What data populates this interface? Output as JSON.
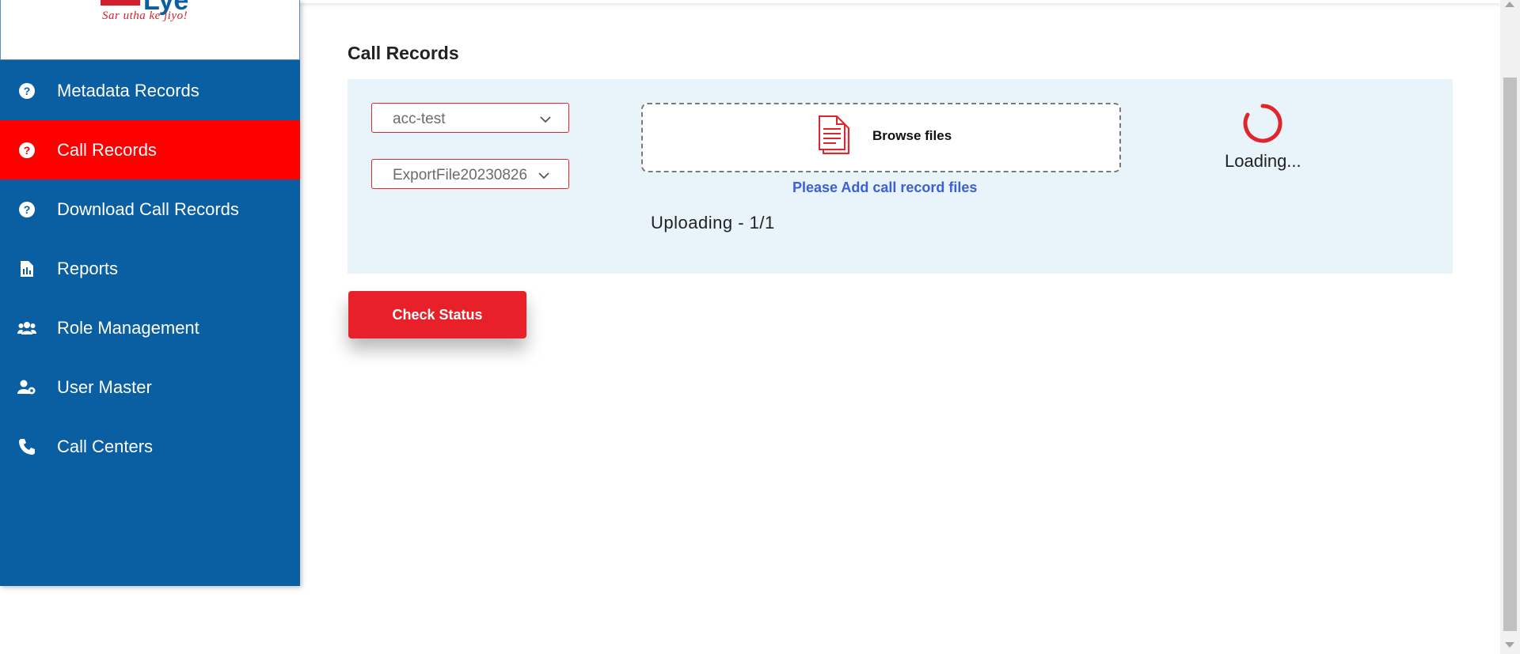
{
  "brand": {
    "logo_text": "Lye",
    "tagline": "Sar utha ke jiyo!",
    "accent": "#d21f2b",
    "primary": "#0a5fa3"
  },
  "sidebar": {
    "items": [
      {
        "label": "Metadata Records",
        "icon": "question-circle-icon",
        "active": false
      },
      {
        "label": "Call Records",
        "icon": "question-circle-icon",
        "active": true
      },
      {
        "label": "Download Call Records",
        "icon": "question-circle-icon",
        "active": false
      },
      {
        "label": "Reports",
        "icon": "report-document-icon",
        "active": false
      },
      {
        "label": "Role Management",
        "icon": "users-group-icon",
        "active": false
      },
      {
        "label": "User Master",
        "icon": "user-settings-icon",
        "active": false
      },
      {
        "label": "Call Centers",
        "icon": "phone-icon",
        "active": false
      }
    ]
  },
  "main": {
    "title": "Call Records",
    "account_select": {
      "value": "acc-test"
    },
    "file_select": {
      "value": "ExportFile20230826"
    },
    "dropzone": {
      "browse_label": "Browse files",
      "icon": "document-icon"
    },
    "hint": "Please Add call record files",
    "upload_status": "Uploading - 1/1",
    "loading_text": "Loading...",
    "check_status_label": "Check Status"
  }
}
